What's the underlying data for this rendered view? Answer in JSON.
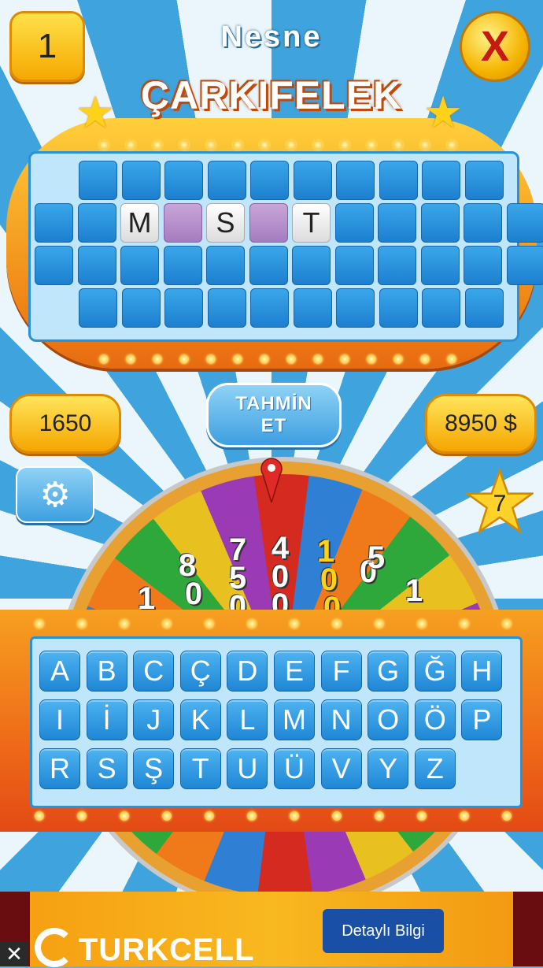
{
  "header": {
    "level": "1",
    "category": "Nesne",
    "close_label": "X",
    "title": "ÇARKIFELEK"
  },
  "board": {
    "rows": [
      [
        "",
        "",
        "",
        "",
        "",
        "",
        "",
        "",
        "",
        ""
      ],
      [
        "",
        "",
        "M",
        "#",
        "S",
        "#",
        "T",
        "",
        "",
        "",
        "",
        ""
      ],
      [
        "",
        "",
        "",
        "",
        "",
        "",
        "",
        "",
        "",
        "",
        "",
        ""
      ],
      [
        "",
        "",
        "",
        "",
        "",
        "",
        "",
        "",
        "",
        ""
      ]
    ],
    "revealed_letters": [
      "M",
      "S",
      "T"
    ]
  },
  "stats": {
    "score": "1650",
    "money": "8950 $",
    "stars": "7"
  },
  "guess_button": {
    "line1": "TAHMİN",
    "line2": "ET"
  },
  "wheel": {
    "visible_values": [
      "1",
      "5",
      "8",
      "0",
      "0",
      "7",
      "5",
      "0",
      "4",
      "0",
      "0",
      "1",
      "0",
      "0",
      "0",
      "5",
      "1"
    ]
  },
  "keyboard": {
    "rows": [
      [
        "A",
        "B",
        "C",
        "Ç",
        "D",
        "E",
        "F",
        "G",
        "Ğ",
        "H"
      ],
      [
        "I",
        "İ",
        "J",
        "K",
        "L",
        "M",
        "N",
        "O",
        "Ö",
        "P"
      ],
      [
        "R",
        "S",
        "Ş",
        "T",
        "U",
        "Ü",
        "V",
        "Y",
        "Z"
      ]
    ]
  },
  "ad": {
    "brand": "TURKCELL",
    "button": "Detaylı Bilgi",
    "close": "✕"
  },
  "colors": {
    "tile_blue": "#1d7fcf",
    "tile_purple": "#a57cc0",
    "gold": "#f5a800",
    "ad_button": "#1a4fa6"
  }
}
